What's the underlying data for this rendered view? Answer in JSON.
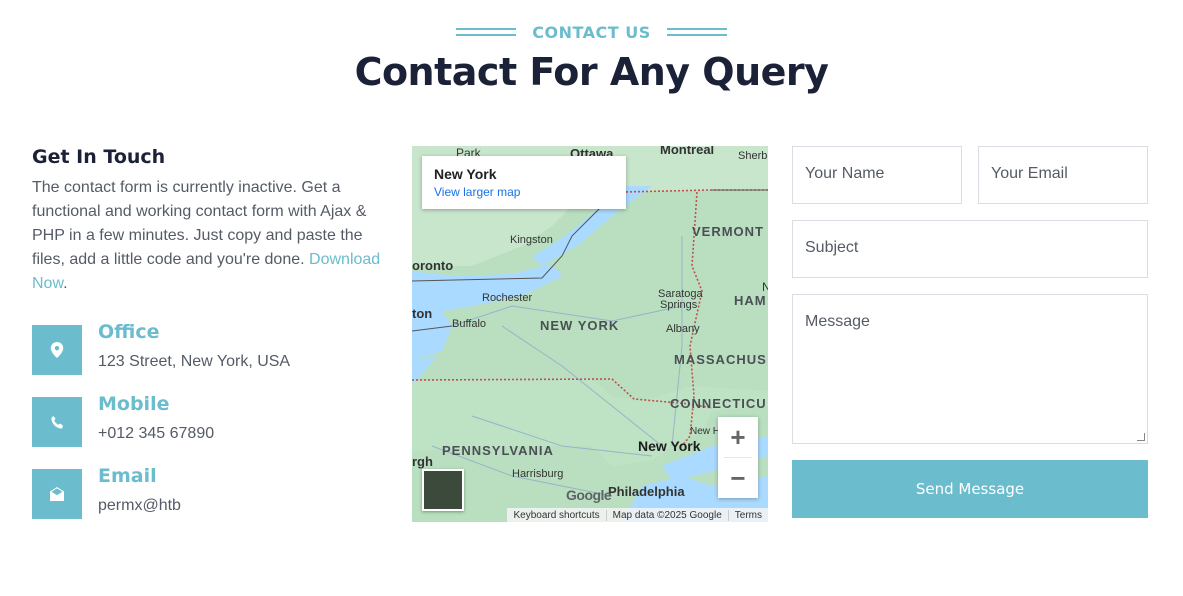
{
  "header": {
    "eyebrow": "CONTACT US",
    "title": "Contact For Any Query"
  },
  "touch": {
    "heading": "Get In Touch",
    "description": "The contact form is currently inactive. Get a functional and working contact form with Ajax & PHP in a few minutes. Just copy and paste the files, add a little code and you're done.",
    "link_text": "Download Now",
    "link_suffix": "."
  },
  "info": [
    {
      "title": "Office",
      "value": "123 Street, New York, USA",
      "icon": "map-marker-icon"
    },
    {
      "title": "Mobile",
      "value": "+012 345 67890",
      "icon": "phone-icon"
    },
    {
      "title": "Email",
      "value": "permx@htb",
      "icon": "envelope-open-icon"
    }
  ],
  "map": {
    "place": "New York",
    "larger_map": "View larger map",
    "labels": {
      "ottawa": "Ottawa",
      "montreal": "Montreal",
      "sherbrooke": "Sherb",
      "park": "Park",
      "vermont": "VERMONT",
      "kingston": "Kingston",
      "toronto": "oronto",
      "rochester": "Rochester",
      "saratoga": "Saratoga",
      "springs": "Springs",
      "ham": "HAM",
      "n": "N",
      "ton": "ton",
      "buffalo": "Buffalo",
      "new_york_state": "NEW YORK",
      "albany": "Albany",
      "massachusetts": "MASSACHUS",
      "connecticut": "CONNECTICU",
      "new_haven": "New H",
      "pennsylvania": "PENNSYLVANIA",
      "new_york_city": "New York",
      "pittsburgh": "rgh",
      "harrisburg": "Harrisburg",
      "philadelphia": "Philadelphia"
    },
    "google": "Google",
    "attribution": [
      "Keyboard shortcuts",
      "Map data ©2025 Google",
      "Terms"
    ],
    "zoom_in": "+",
    "zoom_out": "−"
  },
  "form": {
    "name_placeholder": "Your Name",
    "email_placeholder": "Your Email",
    "subject_placeholder": "Subject",
    "message_placeholder": "Message",
    "submit_label": "Send Message"
  },
  "colors": {
    "accent": "#6bbccd",
    "heading": "#1b2137",
    "text": "#555b66"
  }
}
